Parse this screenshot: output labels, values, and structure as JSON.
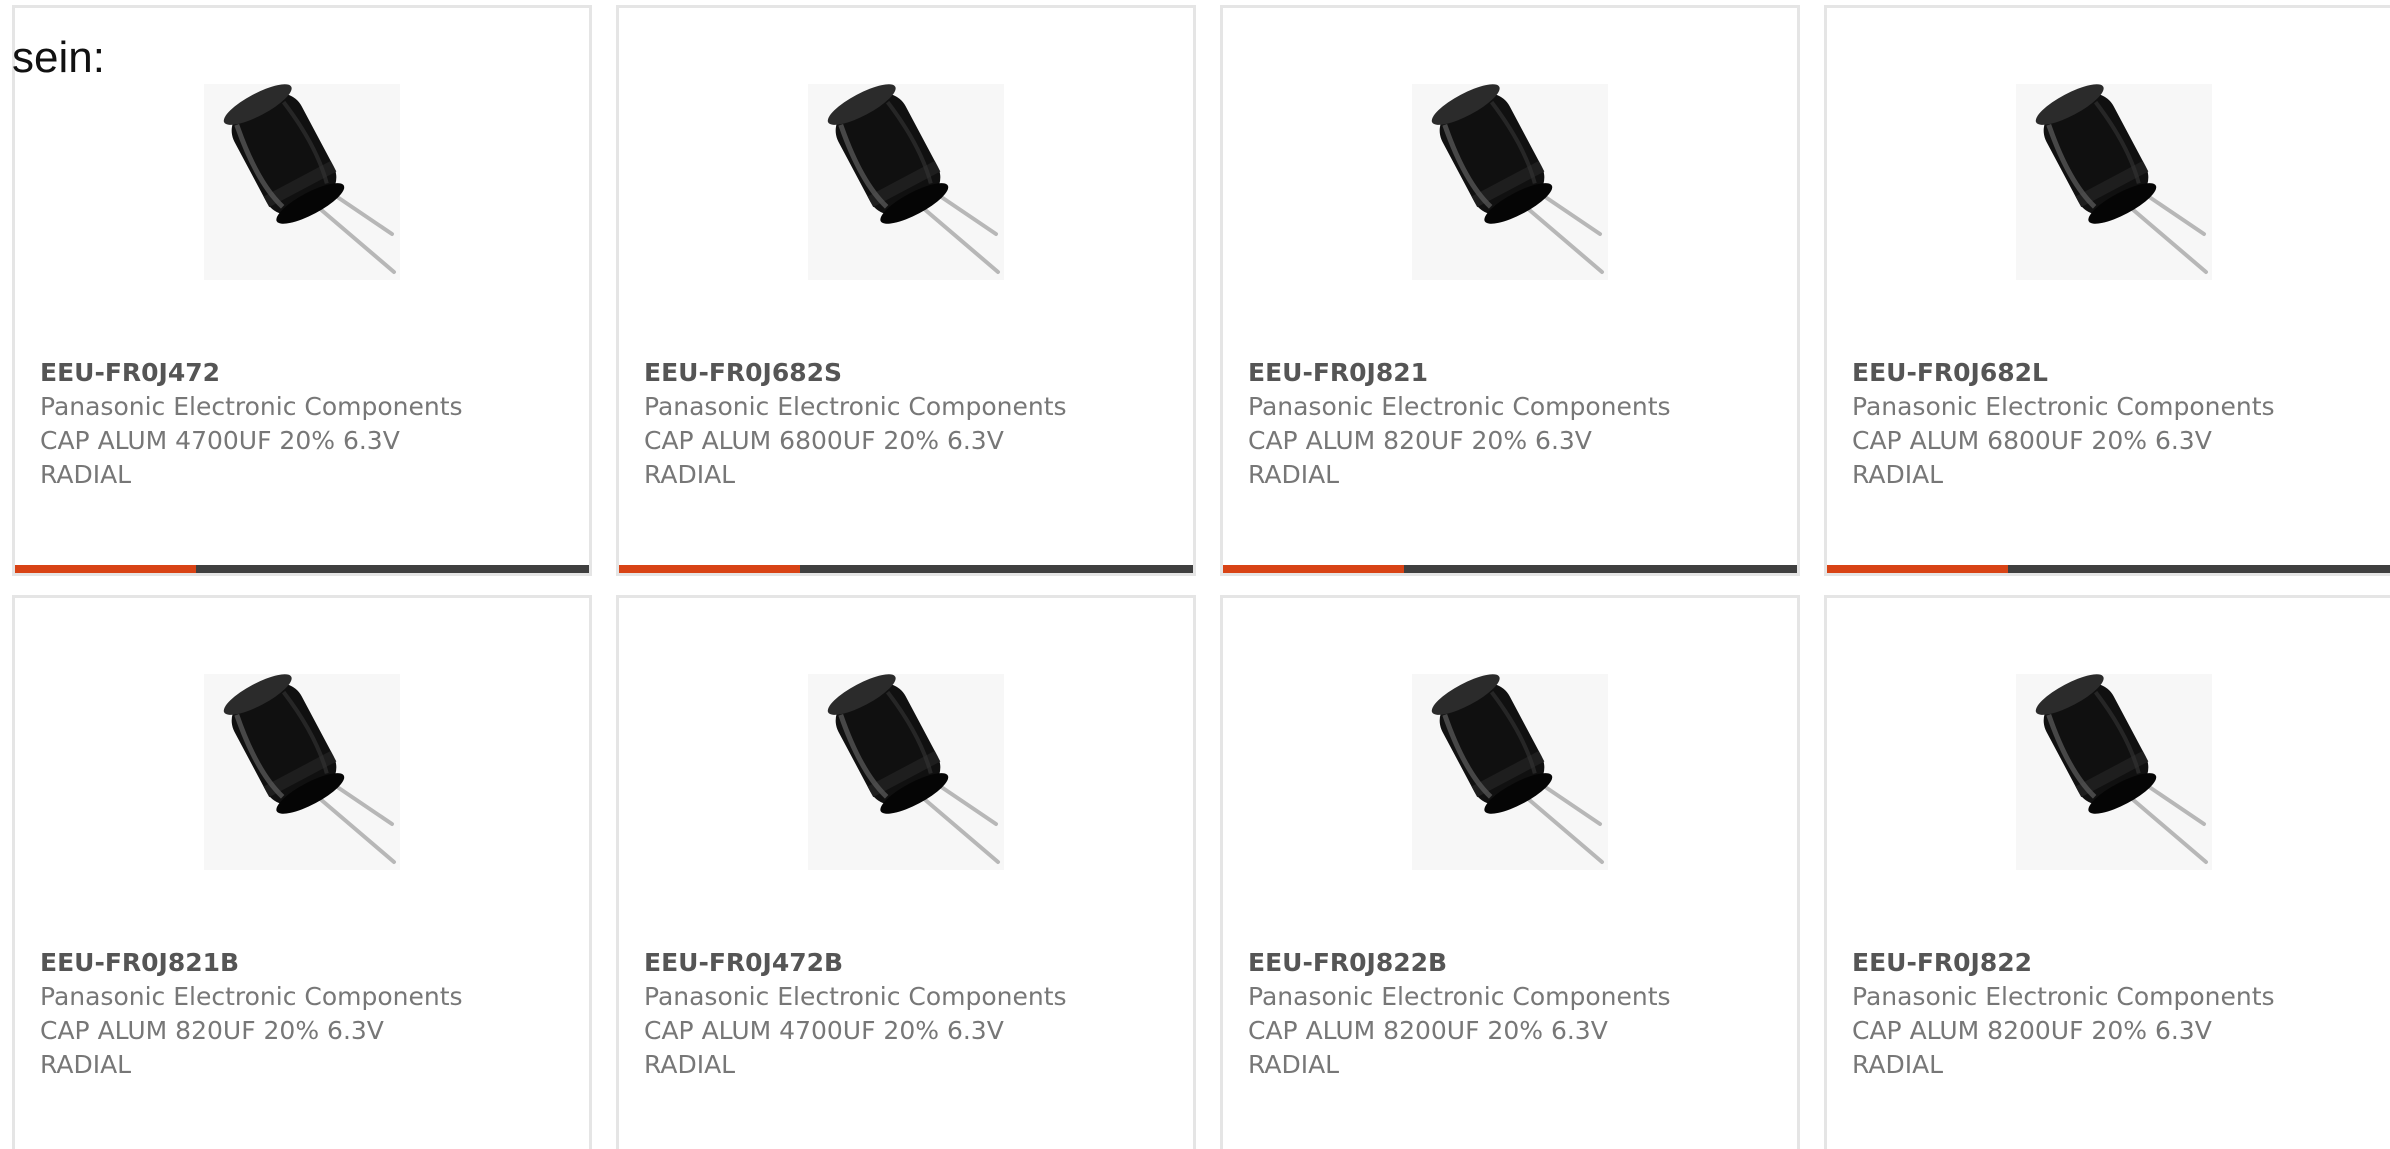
{
  "intro_text": "sein:",
  "colors": {
    "card_border": "#e5e5e5",
    "text": "#777777",
    "part_number": "#555555",
    "progress_track": "#3f3f3f",
    "progress_fill": "#d84315"
  },
  "products": [
    {
      "part_number": "EEU-FR0J472",
      "manufacturer": "Panasonic Electronic Components",
      "description_line1": "CAP ALUM 4700UF 20% 6.3V",
      "description_line2": "RADIAL",
      "image_icon": "radial-capacitor-icon",
      "progress_fraction": 0.316
    },
    {
      "part_number": "EEU-FR0J682S",
      "manufacturer": "Panasonic Electronic Components",
      "description_line1": "CAP ALUM 6800UF 20% 6.3V",
      "description_line2": "RADIAL",
      "image_icon": "radial-capacitor-icon",
      "progress_fraction": 0.316
    },
    {
      "part_number": "EEU-FR0J821",
      "manufacturer": "Panasonic Electronic Components",
      "description_line1": "CAP ALUM 820UF 20% 6.3V",
      "description_line2": "RADIAL",
      "image_icon": "radial-capacitor-icon",
      "progress_fraction": 0.316
    },
    {
      "part_number": "EEU-FR0J682L",
      "manufacturer": "Panasonic Electronic Components",
      "description_line1": "CAP ALUM 6800UF 20% 6.3V",
      "description_line2": "RADIAL",
      "image_icon": "radial-capacitor-icon",
      "progress_fraction": 0.316
    },
    {
      "part_number": "EEU-FR0J821B",
      "manufacturer": "Panasonic Electronic Components",
      "description_line1": "CAP ALUM 820UF 20% 6.3V",
      "description_line2": "RADIAL",
      "image_icon": "radial-capacitor-icon"
    },
    {
      "part_number": "EEU-FR0J472B",
      "manufacturer": "Panasonic Electronic Components",
      "description_line1": "CAP ALUM 4700UF 20% 6.3V",
      "description_line2": "RADIAL",
      "image_icon": "radial-capacitor-icon"
    },
    {
      "part_number": "EEU-FR0J822B",
      "manufacturer": "Panasonic Electronic Components",
      "description_line1": "CAP ALUM 8200UF 20% 6.3V",
      "description_line2": "RADIAL",
      "image_icon": "radial-capacitor-icon"
    },
    {
      "part_number": "EEU-FR0J822",
      "manufacturer": "Panasonic Electronic Components",
      "description_line1": "CAP ALUM 8200UF 20% 6.3V",
      "description_line2": "RADIAL",
      "image_icon": "radial-capacitor-icon"
    }
  ]
}
